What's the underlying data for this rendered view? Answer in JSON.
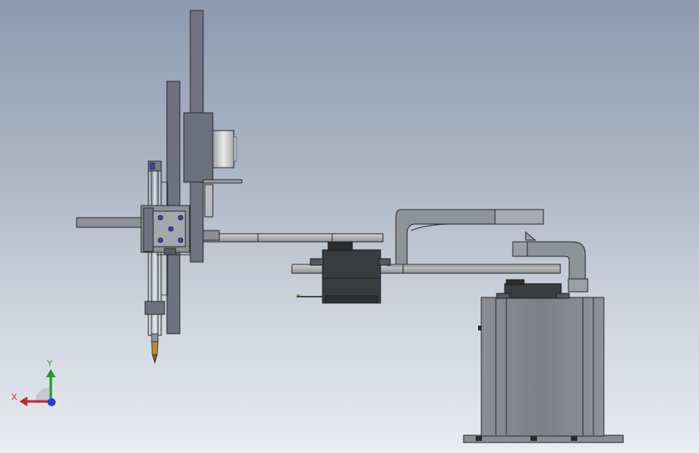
{
  "viewport": {
    "background_top": "#8d9ab0",
    "background_bottom": "#e9ecf0"
  },
  "triad": {
    "x_label": "X",
    "y_label": "Y",
    "x_color": "#c0282e",
    "y_color": "#1f9a2e",
    "z_color": "#1f3fd8"
  },
  "model": {
    "part_color_dark": "#6e7280",
    "part_color_mid": "#8a8e98",
    "part_color_light": "#c9cbd0",
    "servo_color": "#3a3b3e",
    "fastener_color": "#3a45a8",
    "tip_color": "#b98a3c"
  }
}
